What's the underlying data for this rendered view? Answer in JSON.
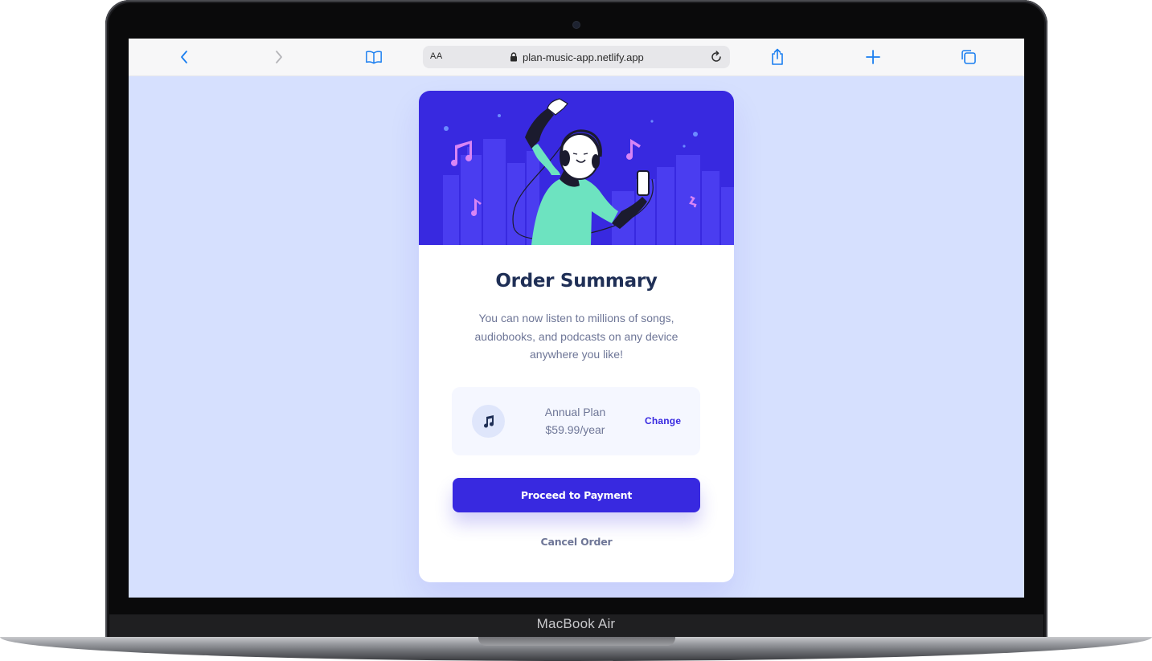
{
  "device": {
    "label": "MacBook Air"
  },
  "browser": {
    "address": {
      "text_size_label": "AA",
      "url": "plan-music-app.netlify.app"
    },
    "icons": {
      "back": "chevron-left-icon",
      "forward": "chevron-right-icon",
      "bookmarks": "book-icon",
      "lock": "lock-icon",
      "reload": "reload-icon",
      "share": "share-icon",
      "new_tab": "plus-icon",
      "tabs": "tabs-icon"
    },
    "accent": "#1a7ef0"
  },
  "page": {
    "background": "#d6e0fe",
    "card": {
      "title": "Order Summary",
      "description": "You can now listen to millions of songs, audiobooks, and podcasts on any device anywhere you like!",
      "plan": {
        "icon": "music-note-icon",
        "name": "Annual Plan",
        "price": "$59.99/year",
        "change_label": "Change"
      },
      "primary_button": "Proceed to Payment",
      "secondary_button": "Cancel Order",
      "colors": {
        "accent": "#3829e0",
        "title": "#1f2f56",
        "text": "#6e7697",
        "hero": "#3829e0",
        "plan_box": "#f5f7ff"
      }
    }
  }
}
